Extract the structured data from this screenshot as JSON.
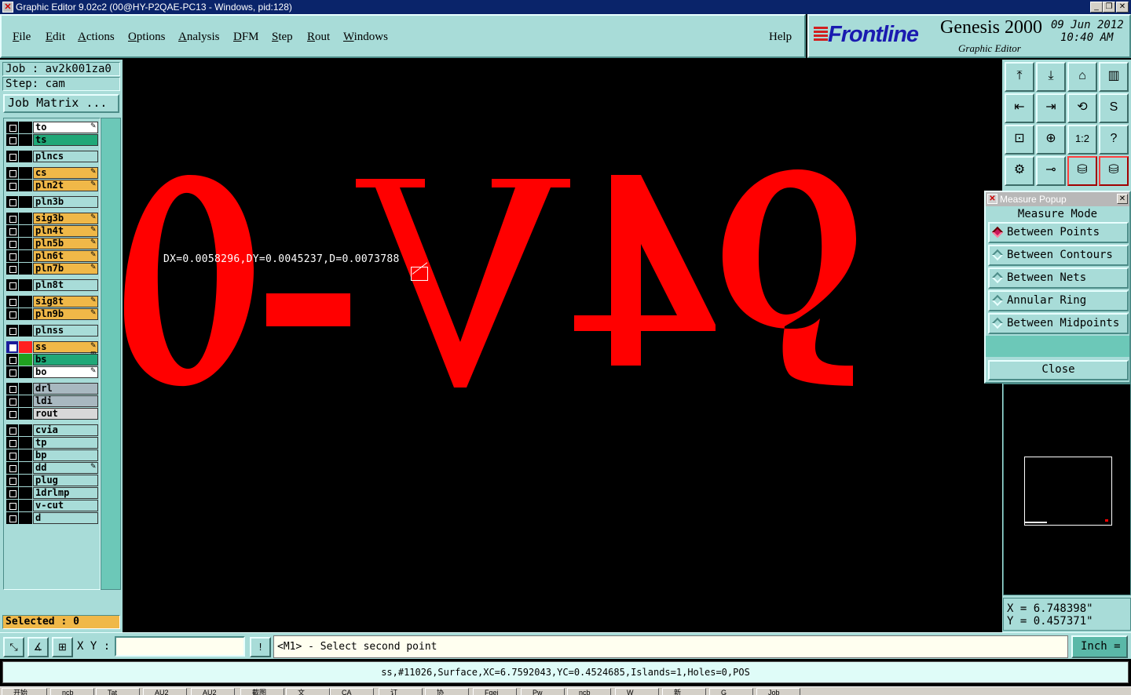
{
  "window": {
    "title": "Graphic Editor 9.02c2 (00@HY-P2QAE-PC13 - Windows, pid:128)",
    "min": "_",
    "max": "❐",
    "close": "✕"
  },
  "menu": {
    "items": [
      {
        "label": "File",
        "ul": "F",
        "rest": "ile"
      },
      {
        "label": "Edit",
        "ul": "E",
        "rest": "dit"
      },
      {
        "label": "Actions",
        "ul": "A",
        "rest": "ctions"
      },
      {
        "label": "Options",
        "ul": "O",
        "rest": "ptions"
      },
      {
        "label": "Analysis",
        "ul": "A",
        "rest": "nalysis"
      },
      {
        "label": "DFM",
        "ul": "D",
        "rest": "FM"
      },
      {
        "label": "Step",
        "ul": "S",
        "rest": "tep"
      },
      {
        "label": "Rout",
        "ul": "R",
        "rest": "out"
      },
      {
        "label": "Windows",
        "ul": "W",
        "rest": "indows"
      }
    ],
    "help": "Help"
  },
  "brand": {
    "logo_text": "Frontline",
    "product": "Genesis 2000",
    "subtitle": "Graphic Editor",
    "date": "09 Jun 2012",
    "time": "10:40 AM"
  },
  "job": {
    "job_label": "Job : av2k001za0",
    "step_label": "Step: cam",
    "matrix_button": "Job Matrix ..."
  },
  "layers": [
    {
      "name": "to",
      "color": "#ffffff",
      "flag": "✎",
      "active": false
    },
    {
      "name": "ts",
      "color": "#20a878",
      "flag": "",
      "active": false
    },
    {
      "name": "plncs",
      "color": "#a8dcd8",
      "flag": "",
      "active": false
    },
    {
      "name": "cs",
      "color": "#f0b848",
      "flag": "✎",
      "active": false
    },
    {
      "name": "pln2t",
      "color": "#f0b848",
      "flag": "✎",
      "active": false
    },
    {
      "name": "pln3b",
      "color": "#a8dcd8",
      "flag": "",
      "active": false
    },
    {
      "name": "sig3b",
      "color": "#f0b848",
      "flag": "✎",
      "active": false
    },
    {
      "name": "pln4t",
      "color": "#f0b848",
      "flag": "✎",
      "active": false
    },
    {
      "name": "pln5b",
      "color": "#f0b848",
      "flag": "✎",
      "active": false
    },
    {
      "name": "pln6t",
      "color": "#f0b848",
      "flag": "✎",
      "active": false
    },
    {
      "name": "pln7b",
      "color": "#f0b848",
      "flag": "✎",
      "active": false
    },
    {
      "name": "pln8t",
      "color": "#a8dcd8",
      "flag": "",
      "active": false
    },
    {
      "name": "sig8t",
      "color": "#f0b848",
      "flag": "✎",
      "active": false
    },
    {
      "name": "pln9b",
      "color": "#f0b848",
      "flag": "✎",
      "active": false
    },
    {
      "name": "plnss",
      "color": "#a8dcd8",
      "flag": "",
      "active": false
    },
    {
      "name": "ss",
      "color": "#f0b848",
      "flag": "✎ ⊞",
      "active": true,
      "swatch": "#ff2020"
    },
    {
      "name": "bs",
      "color": "#20a878",
      "flag": "",
      "active": false,
      "swatch": "#20a020"
    },
    {
      "name": "bo",
      "color": "#ffffff",
      "flag": "✎",
      "active": false
    },
    {
      "name": "drl",
      "color": "#a8b8c0",
      "flag": "",
      "active": false
    },
    {
      "name": "ldi",
      "color": "#a8b8c0",
      "flag": "",
      "active": false
    },
    {
      "name": "rout",
      "color": "#d8d8d8",
      "flag": "",
      "active": false
    },
    {
      "name": "cvia",
      "color": "#a8dcd8",
      "flag": "",
      "active": false
    },
    {
      "name": "tp",
      "color": "#a8dcd8",
      "flag": "",
      "active": false
    },
    {
      "name": "bp",
      "color": "#a8dcd8",
      "flag": "",
      "active": false
    },
    {
      "name": "dd",
      "color": "#a8dcd8",
      "flag": "✎",
      "active": false
    },
    {
      "name": "plug",
      "color": "#a8dcd8",
      "flag": "",
      "active": false
    },
    {
      "name": "1drlmp",
      "color": "#a8dcd8",
      "flag": "",
      "active": false
    },
    {
      "name": "v-cut",
      "color": "#a8dcd8",
      "flag": "",
      "active": false
    },
    {
      "name": "d",
      "color": "#a8dcd8",
      "flag": "",
      "active": false
    }
  ],
  "selected": "Selected : 0",
  "canvas": {
    "measure_text": "DX=0.0058296,DY=0.0045237,D=0.0073788",
    "glyph_text": "0-V4e",
    "glyph_color": "#ff0000"
  },
  "tools": [
    {
      "icon": "⤒",
      "name": "zoom-home-icon"
    },
    {
      "icon": "⤓",
      "name": "zoom-down-icon"
    },
    {
      "icon": "⌂",
      "name": "home-icon"
    },
    {
      "icon": "▥",
      "name": "window-icon"
    },
    {
      "icon": "⇤",
      "name": "pan-left-icon"
    },
    {
      "icon": "⇥",
      "name": "pan-right-icon"
    },
    {
      "icon": "⟲",
      "name": "undo-icon"
    },
    {
      "icon": "S",
      "name": "snap-icon"
    },
    {
      "icon": "⊡",
      "name": "zoom-fit-icon"
    },
    {
      "icon": "⊕",
      "name": "zoom-center-icon"
    },
    {
      "icon": "1:2",
      "name": "scale-icon"
    },
    {
      "icon": "?",
      "name": "help-icon"
    },
    {
      "icon": "⚙",
      "name": "tools-icon"
    },
    {
      "icon": "⊸",
      "name": "probe-icon"
    },
    {
      "icon": "⛁",
      "name": "netlist-icon"
    },
    {
      "icon": "⛁",
      "name": "netlist-compare-icon"
    }
  ],
  "measure_popup": {
    "title": "Measure Popup",
    "mode_label": "Measure Mode",
    "options": [
      "Between Points",
      "Between Contours",
      "Between Nets",
      "Annular Ring",
      "Between Midpoints"
    ],
    "selected": 0,
    "close_label": "Close"
  },
  "coords": {
    "x": "X = 6.748398\"",
    "y": "Y = 0.457371\""
  },
  "cmd": {
    "xy_label": "X Y :",
    "xy_value": "",
    "prompt": "<M1> - Select second point",
    "unit": "Inch ="
  },
  "status": "ss,#11026,Surface,XC=6.7592043,YC=0.4524685,Islands=1,Holes=0,POS",
  "taskbar": [
    "开始",
    "ncb",
    "Tat",
    "AU2",
    "AU2",
    "截图",
    "文",
    "CA",
    "订",
    "协",
    "Fgei",
    "Pw",
    "ncb",
    "W",
    "新",
    "G",
    "Job"
  ]
}
